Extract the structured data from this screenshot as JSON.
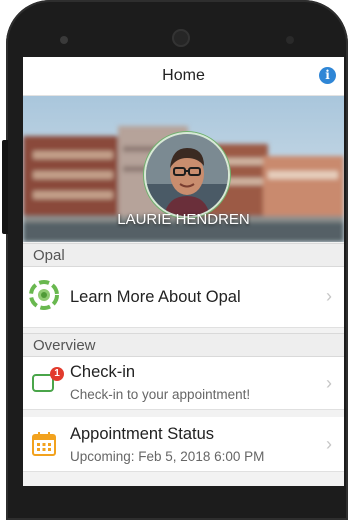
{
  "header": {
    "title": "Home",
    "info_icon": "info-icon"
  },
  "profile": {
    "name": "LAURIE HENDREN"
  },
  "sections": [
    {
      "label": "Opal"
    },
    {
      "label": "Overview"
    }
  ],
  "items": [
    {
      "title": "Learn More About Opal",
      "subtitle": "",
      "icon": "opal-logo-icon"
    },
    {
      "title": "Check-in",
      "subtitle": "Check-in to your appointment!",
      "icon": "checkin-icon",
      "badge": "1"
    },
    {
      "title": "Appointment Status",
      "subtitle": "Upcoming: Feb 5, 2018 6:00 PM",
      "icon": "calendar-icon"
    }
  ],
  "colors": {
    "accent": "#2f86d6",
    "opal_green": "#69b84f",
    "badge_red": "#e23b2d",
    "calendar_orange": "#f2a21e"
  }
}
